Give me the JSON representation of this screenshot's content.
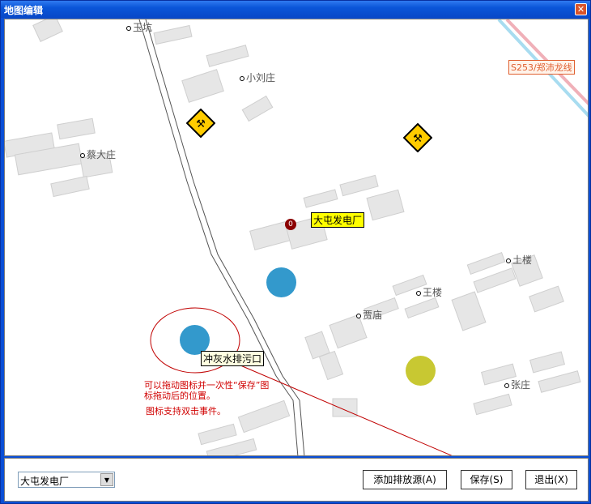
{
  "window": {
    "title": "地图编辑",
    "close_icon": "close-icon"
  },
  "map": {
    "places": [
      "玉坑",
      "小刘庄",
      "蔡大庄",
      "土楼",
      "王楼",
      "贾庙",
      "张庄"
    ],
    "road_label": "S253/郑沛龙线",
    "markers": {
      "power_plant": "大屯发电厂",
      "outlet": "冲灰水排污口"
    },
    "notes": [
      "可以拖动图标并一次性“保存”图标拖动后的位置。",
      "图标支持双击事件。"
    ],
    "colors": {
      "marker_blue": "#3399cc",
      "marker_yellow": "#c8c832",
      "marker_red": "#8b0000",
      "label_yellow": "#ffff00",
      "note_red": "#d00000"
    }
  },
  "bottom": {
    "source_select": "大屯发电厂",
    "add_button": "添加排放源(A)",
    "save_button": "保存(S)",
    "exit_button": "退出(X)"
  }
}
